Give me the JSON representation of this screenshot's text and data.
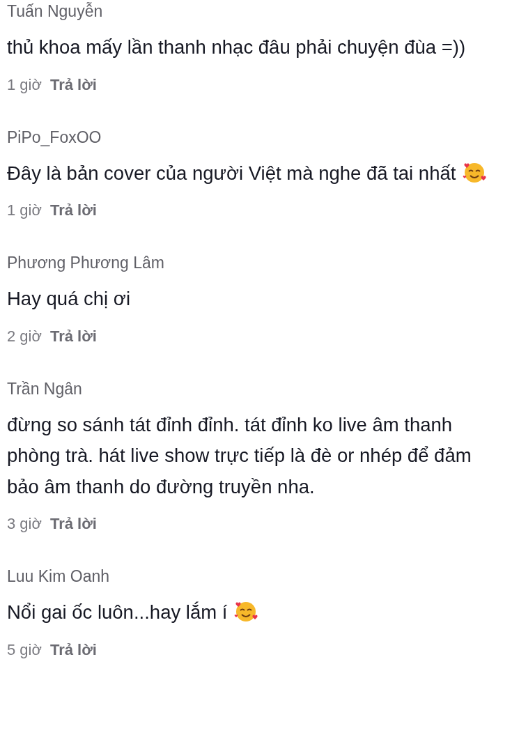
{
  "comments": [
    {
      "author": "Tuấn Nguyễn",
      "text": "thủ khoa mấy lần thanh nhạc đâu phải chuyện đùa =))",
      "emoji": false,
      "time": "1 giờ",
      "reply": "Trả lời"
    },
    {
      "author": "PiPo_FoxOO",
      "text": "Đây là bản cover của người Việt mà nghe đã tai nhất",
      "emoji": true,
      "time": "1 giờ",
      "reply": "Trả lời"
    },
    {
      "author": "Phương Phương Lâm",
      "text": "Hay quá chị ơi",
      "emoji": false,
      "time": "2 giờ",
      "reply": "Trả lời"
    },
    {
      "author": "Trần Ngân",
      "text": "đừng so sánh tát đỉnh đỉnh. tát đỉnh ko live âm thanh phòng trà. hát live show trực tiếp là đè or nhép để đảm bảo âm thanh do đường truyền nha.",
      "emoji": false,
      "time": "3 giờ",
      "reply": "Trả lời"
    },
    {
      "author": "Luu Kim Oanh",
      "text": "Nổi gai ốc luôn...hay lắm í",
      "emoji": true,
      "time": "5 giờ",
      "reply": "Trả lời"
    }
  ]
}
